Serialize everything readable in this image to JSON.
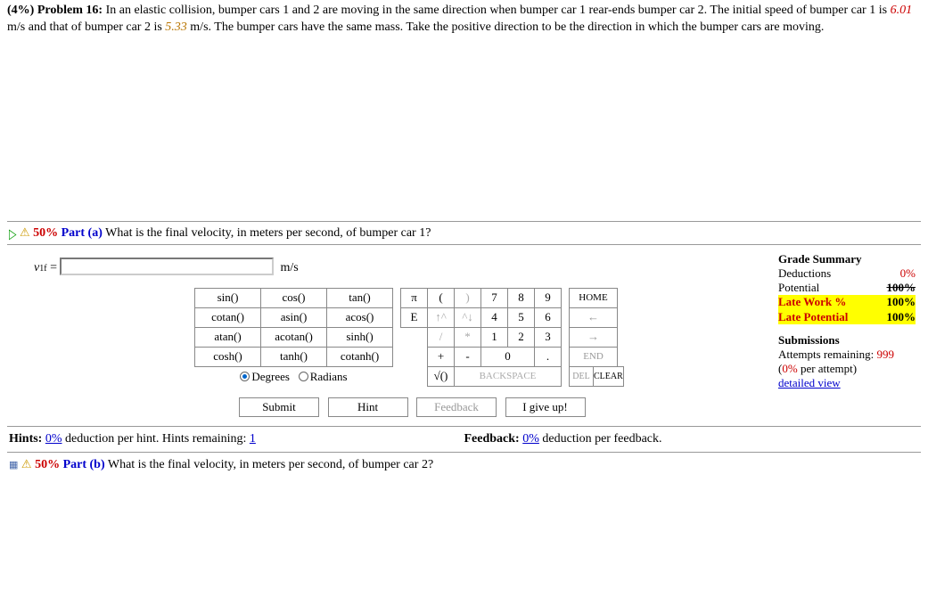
{
  "problem": {
    "weight_lead": "(4%) Problem 16:",
    "text_pre": "   In an elastic collision, bumper cars 1 and 2 are moving in the same direction when bumper car 1 rear-ends bumper car 2. The initial speed of bumper car 1 is ",
    "v1": "6.01",
    "unit1": " m/s and that of bumper car 2 is ",
    "v2": "5.33",
    "text_post": " m/s. The bumper cars have the same mass. Take the positive direction to be the direction in which the bumper cars are moving."
  },
  "part_a": {
    "icons": {
      "tri": "▷",
      "warn": "⚠"
    },
    "pct": "50%",
    "label": "Part (a)",
    "question": "What is the final velocity, in meters per second, of bumper car 1?",
    "var": "v",
    "var_sub": "1f",
    "eq": " = ",
    "unit": "m/s"
  },
  "fn": [
    [
      "sin()",
      "cos()",
      "tan()"
    ],
    [
      "cotan()",
      "asin()",
      "acos()"
    ],
    [
      "atan()",
      "acotan()",
      "sinh()"
    ],
    [
      "cosh()",
      "tanh()",
      "cotanh()"
    ]
  ],
  "deg": {
    "deg_label": "Degrees",
    "rad_label": "Radians"
  },
  "keypad": [
    {
      "cells": [
        {
          "t": "π"
        },
        {
          "t": "("
        },
        {
          "t": ")",
          "dis": true
        },
        {
          "t": "7"
        },
        {
          "t": "8"
        },
        {
          "t": "9"
        }
      ],
      "ctl": "HOME"
    },
    {
      "cells": [
        {
          "t": "E"
        },
        {
          "t": "↑^",
          "dis": true
        },
        {
          "t": "^↓",
          "dis": true
        },
        {
          "t": "4"
        },
        {
          "t": "5"
        },
        {
          "t": "6"
        }
      ],
      "ctl": "←",
      "ctl_dis": true
    },
    {
      "cells": [
        {
          "t": "/",
          "dis": true
        },
        {
          "t": "*",
          "dis": true
        },
        {
          "t": "1"
        },
        {
          "t": "2"
        },
        {
          "t": "3"
        }
      ],
      "ctl": "→",
      "ctl_dis": true,
      "blank_first": true
    },
    {
      "cells": [
        {
          "t": "+"
        },
        {
          "t": "-"
        },
        {
          "t": "0"
        },
        {
          "t": "."
        }
      ],
      "ctl": "END",
      "ctl_dis": true,
      "blank_first": true,
      "blank_mid": true
    }
  ],
  "kp_last": {
    "root": "√()",
    "back": "BACKSPACE",
    "del": "DEL",
    "clear": "CLEAR"
  },
  "buttons": {
    "submit": "Submit",
    "hint": "Hint",
    "feedback": "Feedback",
    "giveup": "I give up!"
  },
  "grade": {
    "head": "Grade Summary",
    "ded_l": "Deductions",
    "ded_v": "0%",
    "pot_l": "Potential",
    "pot_v": "100%",
    "late_l": "Late Work %",
    "late_v": "100%",
    "latep_l": "Late Potential",
    "latep_v": "100%",
    "sub_head": "Submissions",
    "att_l": "Attempts remaining: ",
    "att_v": "999",
    "per": "(",
    "per_v": "0%",
    "per_t": " per attempt)",
    "detail": "detailed view"
  },
  "hints": {
    "lead": "Hints: ",
    "pct": "0%",
    "mid": " deduction per hint. Hints remaining: ",
    "rem": "1"
  },
  "feedback": {
    "lead": "Feedback: ",
    "pct": "0%",
    "tail": " deduction per feedback."
  },
  "part_b": {
    "icons": {
      "sq": "▦",
      "warn": "⚠"
    },
    "pct": "50%",
    "label": "Part (b)",
    "question": "What is the final velocity, in meters per second, of bumper car 2?"
  }
}
